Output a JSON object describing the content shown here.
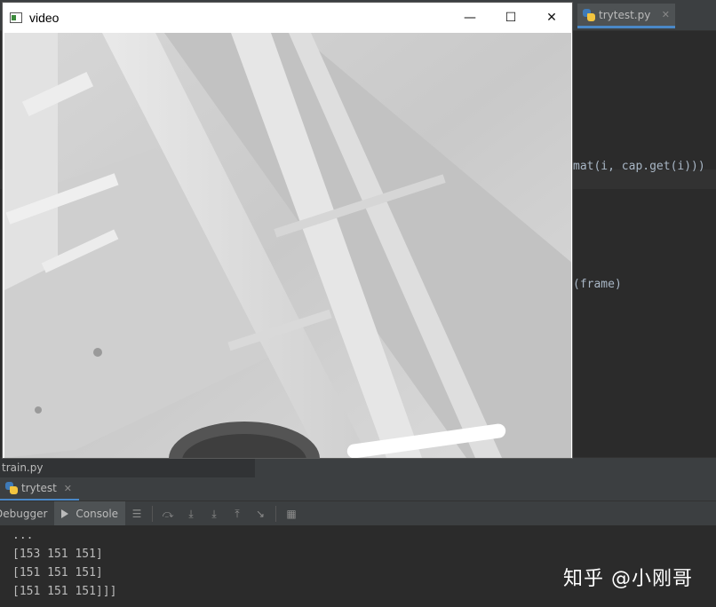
{
  "ide": {
    "tab_label": "trytest.py",
    "tab_close": "✕",
    "code_lines": [
      "mat(i, cap.get(i)))",
      "(frame)"
    ],
    "status_file": "train.py",
    "run_tab_label": "trytest",
    "run_tab_close": "✕",
    "debug_tabs": [
      "Debugger",
      "Console"
    ],
    "console_lines": [
      "...",
      "[153 151 151]",
      "[151 151 151]",
      "[151 151 151]]]"
    ]
  },
  "video_window": {
    "title": "video",
    "minimize": "—",
    "maximize": "☐",
    "close": "✕"
  },
  "watermark": "知乎 @小刚哥"
}
